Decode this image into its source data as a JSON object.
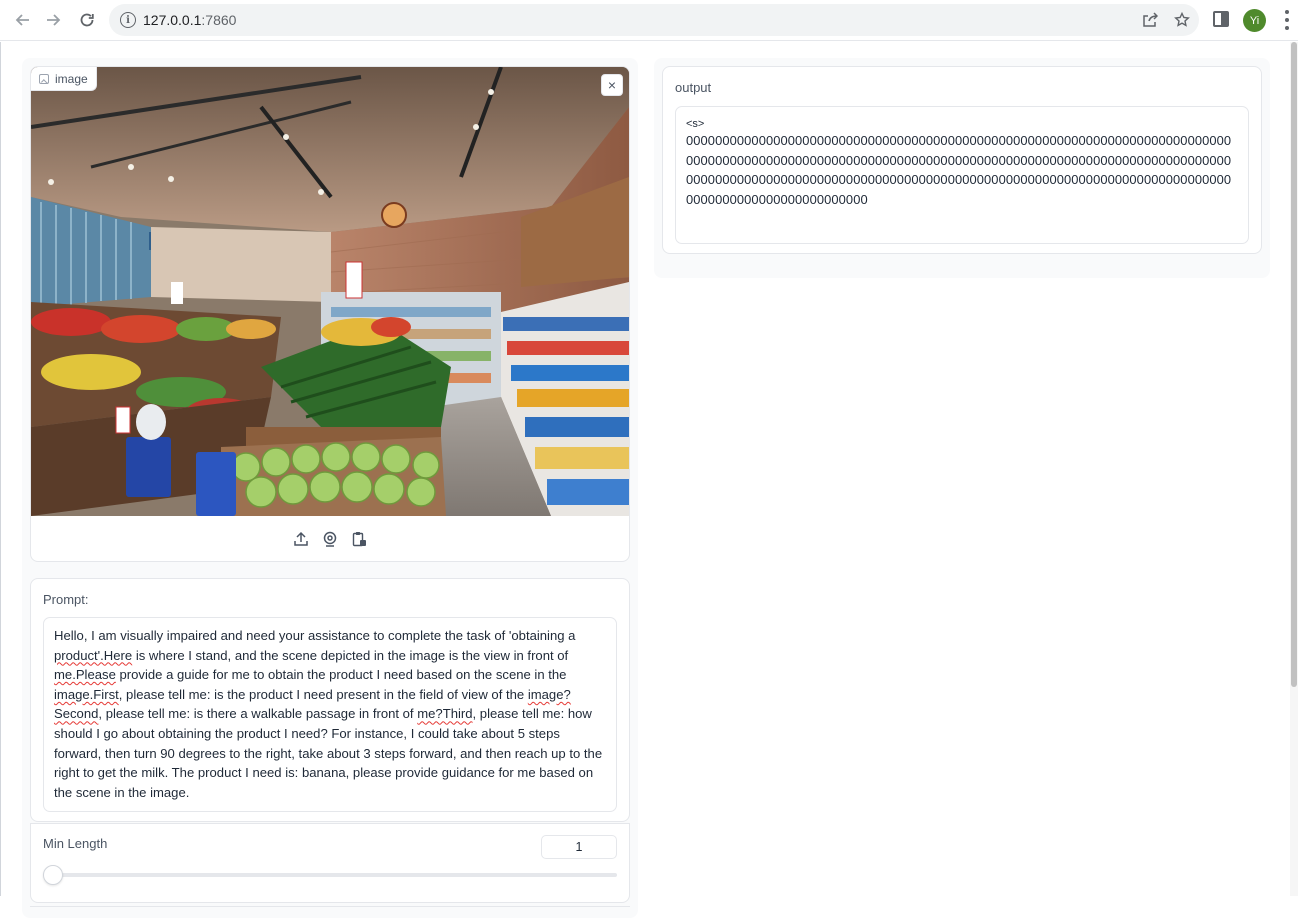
{
  "browser": {
    "url_host": "127.0.0.1",
    "url_port": ":7860",
    "avatar_initials": "Yi",
    "icons": [
      "back-arrow-icon",
      "forward-arrow-icon",
      "reload-icon",
      "site-info-icon",
      "share-icon",
      "bookmark-star-icon",
      "side-panel-icon",
      "menu-kebab-icon"
    ]
  },
  "image_block": {
    "label": "image",
    "close_glyph": "×",
    "toolbar_icons": [
      "upload-icon",
      "webcam-icon",
      "clipboard-icon"
    ]
  },
  "prompt": {
    "label": "Prompt:",
    "parts": [
      {
        "t": "Hello, I am visually impaired and need your assistance to complete the task of 'obtaining a ",
        "s": false
      },
      {
        "t": "product'.Here",
        "s": true
      },
      {
        "t": " is where I stand, and the scene depicted in the image is the view in front of ",
        "s": false
      },
      {
        "t": "me.Please",
        "s": true
      },
      {
        "t": " provide a guide for me to obtain the product I need based on the scene in the ",
        "s": false
      },
      {
        "t": "image.First",
        "s": true
      },
      {
        "t": ", please tell me: is the product I need present in the field of view of the ",
        "s": false
      },
      {
        "t": "image?",
        "s": true
      },
      {
        "t": " ",
        "s": false
      },
      {
        "t": "Second",
        "s": true
      },
      {
        "t": ", please tell me: is there a walkable passage in front of ",
        "s": false
      },
      {
        "t": "me?Third",
        "s": true
      },
      {
        "t": ", please tell me: how should I go about obtaining the product I need? For instance, I could take about 5 steps forward, then turn 90 degrees to the right, take about 3 steps forward, and then reach up to the right to get the milk. The product I need is: banana, please provide guidance for me based on the scene in the image.",
        "s": false
      }
    ]
  },
  "min_length": {
    "label": "Min Length",
    "value": "1",
    "slider_fraction": 0
  },
  "output": {
    "label": "output",
    "tag": "<s>",
    "text": "0000000000000000000000000000000000000000000000000000000000000000000000000000000000000000000000000000000000000000000000000000000000000000000000000000000000000000000000000000000000000000000000000000000000000000000000000000000000000000000000000000000000"
  }
}
